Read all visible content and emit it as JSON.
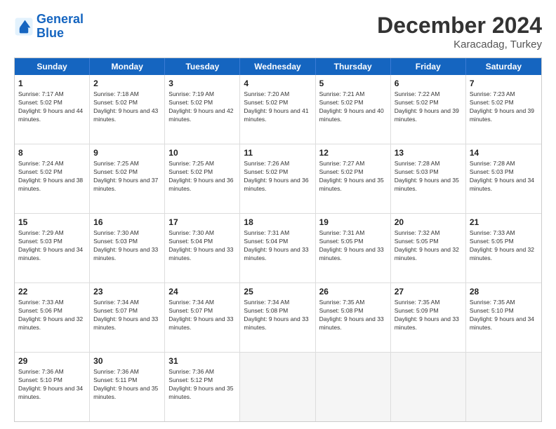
{
  "logo": {
    "line1": "General",
    "line2": "Blue"
  },
  "header": {
    "month": "December 2024",
    "location": "Karacadag, Turkey"
  },
  "weekdays": [
    "Sunday",
    "Monday",
    "Tuesday",
    "Wednesday",
    "Thursday",
    "Friday",
    "Saturday"
  ],
  "weeks": [
    [
      {
        "day": "1",
        "sunrise": "Sunrise: 7:17 AM",
        "sunset": "Sunset: 5:02 PM",
        "daylight": "Daylight: 9 hours and 44 minutes."
      },
      {
        "day": "2",
        "sunrise": "Sunrise: 7:18 AM",
        "sunset": "Sunset: 5:02 PM",
        "daylight": "Daylight: 9 hours and 43 minutes."
      },
      {
        "day": "3",
        "sunrise": "Sunrise: 7:19 AM",
        "sunset": "Sunset: 5:02 PM",
        "daylight": "Daylight: 9 hours and 42 minutes."
      },
      {
        "day": "4",
        "sunrise": "Sunrise: 7:20 AM",
        "sunset": "Sunset: 5:02 PM",
        "daylight": "Daylight: 9 hours and 41 minutes."
      },
      {
        "day": "5",
        "sunrise": "Sunrise: 7:21 AM",
        "sunset": "Sunset: 5:02 PM",
        "daylight": "Daylight: 9 hours and 40 minutes."
      },
      {
        "day": "6",
        "sunrise": "Sunrise: 7:22 AM",
        "sunset": "Sunset: 5:02 PM",
        "daylight": "Daylight: 9 hours and 39 minutes."
      },
      {
        "day": "7",
        "sunrise": "Sunrise: 7:23 AM",
        "sunset": "Sunset: 5:02 PM",
        "daylight": "Daylight: 9 hours and 39 minutes."
      }
    ],
    [
      {
        "day": "8",
        "sunrise": "Sunrise: 7:24 AM",
        "sunset": "Sunset: 5:02 PM",
        "daylight": "Daylight: 9 hours and 38 minutes."
      },
      {
        "day": "9",
        "sunrise": "Sunrise: 7:25 AM",
        "sunset": "Sunset: 5:02 PM",
        "daylight": "Daylight: 9 hours and 37 minutes."
      },
      {
        "day": "10",
        "sunrise": "Sunrise: 7:25 AM",
        "sunset": "Sunset: 5:02 PM",
        "daylight": "Daylight: 9 hours and 36 minutes."
      },
      {
        "day": "11",
        "sunrise": "Sunrise: 7:26 AM",
        "sunset": "Sunset: 5:02 PM",
        "daylight": "Daylight: 9 hours and 36 minutes."
      },
      {
        "day": "12",
        "sunrise": "Sunrise: 7:27 AM",
        "sunset": "Sunset: 5:02 PM",
        "daylight": "Daylight: 9 hours and 35 minutes."
      },
      {
        "day": "13",
        "sunrise": "Sunrise: 7:28 AM",
        "sunset": "Sunset: 5:03 PM",
        "daylight": "Daylight: 9 hours and 35 minutes."
      },
      {
        "day": "14",
        "sunrise": "Sunrise: 7:28 AM",
        "sunset": "Sunset: 5:03 PM",
        "daylight": "Daylight: 9 hours and 34 minutes."
      }
    ],
    [
      {
        "day": "15",
        "sunrise": "Sunrise: 7:29 AM",
        "sunset": "Sunset: 5:03 PM",
        "daylight": "Daylight: 9 hours and 34 minutes."
      },
      {
        "day": "16",
        "sunrise": "Sunrise: 7:30 AM",
        "sunset": "Sunset: 5:03 PM",
        "daylight": "Daylight: 9 hours and 33 minutes."
      },
      {
        "day": "17",
        "sunrise": "Sunrise: 7:30 AM",
        "sunset": "Sunset: 5:04 PM",
        "daylight": "Daylight: 9 hours and 33 minutes."
      },
      {
        "day": "18",
        "sunrise": "Sunrise: 7:31 AM",
        "sunset": "Sunset: 5:04 PM",
        "daylight": "Daylight: 9 hours and 33 minutes."
      },
      {
        "day": "19",
        "sunrise": "Sunrise: 7:31 AM",
        "sunset": "Sunset: 5:05 PM",
        "daylight": "Daylight: 9 hours and 33 minutes."
      },
      {
        "day": "20",
        "sunrise": "Sunrise: 7:32 AM",
        "sunset": "Sunset: 5:05 PM",
        "daylight": "Daylight: 9 hours and 32 minutes."
      },
      {
        "day": "21",
        "sunrise": "Sunrise: 7:33 AM",
        "sunset": "Sunset: 5:05 PM",
        "daylight": "Daylight: 9 hours and 32 minutes."
      }
    ],
    [
      {
        "day": "22",
        "sunrise": "Sunrise: 7:33 AM",
        "sunset": "Sunset: 5:06 PM",
        "daylight": "Daylight: 9 hours and 32 minutes."
      },
      {
        "day": "23",
        "sunrise": "Sunrise: 7:34 AM",
        "sunset": "Sunset: 5:07 PM",
        "daylight": "Daylight: 9 hours and 33 minutes."
      },
      {
        "day": "24",
        "sunrise": "Sunrise: 7:34 AM",
        "sunset": "Sunset: 5:07 PM",
        "daylight": "Daylight: 9 hours and 33 minutes."
      },
      {
        "day": "25",
        "sunrise": "Sunrise: 7:34 AM",
        "sunset": "Sunset: 5:08 PM",
        "daylight": "Daylight: 9 hours and 33 minutes."
      },
      {
        "day": "26",
        "sunrise": "Sunrise: 7:35 AM",
        "sunset": "Sunset: 5:08 PM",
        "daylight": "Daylight: 9 hours and 33 minutes."
      },
      {
        "day": "27",
        "sunrise": "Sunrise: 7:35 AM",
        "sunset": "Sunset: 5:09 PM",
        "daylight": "Daylight: 9 hours and 33 minutes."
      },
      {
        "day": "28",
        "sunrise": "Sunrise: 7:35 AM",
        "sunset": "Sunset: 5:10 PM",
        "daylight": "Daylight: 9 hours and 34 minutes."
      }
    ],
    [
      {
        "day": "29",
        "sunrise": "Sunrise: 7:36 AM",
        "sunset": "Sunset: 5:10 PM",
        "daylight": "Daylight: 9 hours and 34 minutes."
      },
      {
        "day": "30",
        "sunrise": "Sunrise: 7:36 AM",
        "sunset": "Sunset: 5:11 PM",
        "daylight": "Daylight: 9 hours and 35 minutes."
      },
      {
        "day": "31",
        "sunrise": "Sunrise: 7:36 AM",
        "sunset": "Sunset: 5:12 PM",
        "daylight": "Daylight: 9 hours and 35 minutes."
      },
      null,
      null,
      null,
      null
    ]
  ]
}
